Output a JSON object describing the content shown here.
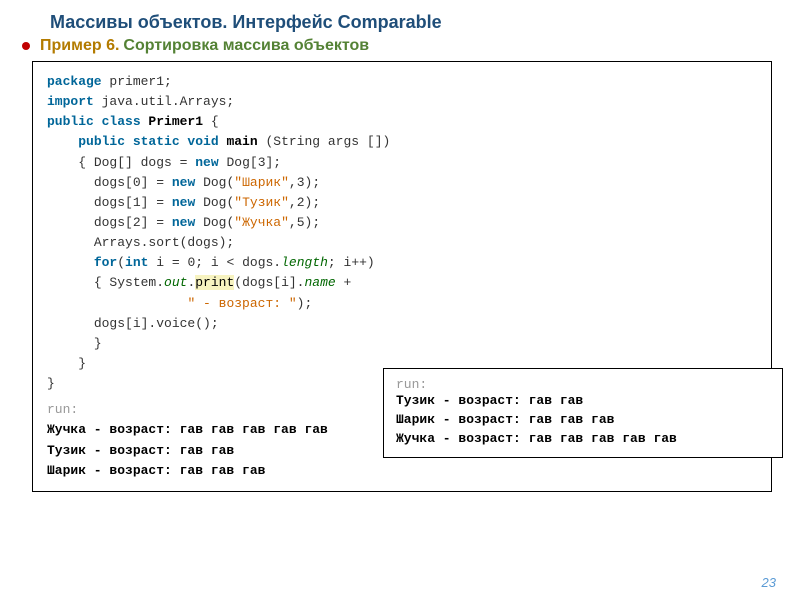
{
  "header": {
    "title": "Массивы объектов. Интерфейс Comparable",
    "example": "Пример 6.",
    "desc": "Сортировка массива объектов"
  },
  "code": {
    "ind1": "    ",
    "ind2": "      ",
    "ind4": "                  ",
    "l1": {
      "a": "package ",
      "b": "primer1;"
    },
    "l2": {
      "a": "import ",
      "b": "java.util.Arrays;"
    },
    "l3": {
      "a": "public class ",
      "b": "Primer1",
      "c": " {"
    },
    "l4": {
      "a": "public static void ",
      "b": "main",
      "c": " (String args [])"
    },
    "l5": {
      "a": "{ Dog[] dogs = ",
      "b": "new ",
      "c": "Dog[",
      "d": "3",
      "e": "];"
    },
    "l6": {
      "a": "dogs[",
      "b": "0",
      "c": "] = ",
      "d": "new ",
      "e": "Dog(",
      "f": "\"Шарик\"",
      "g": ",",
      "h": "3",
      "i": ");"
    },
    "l7": {
      "a": "dogs[",
      "b": "1",
      "c": "] = ",
      "d": "new ",
      "e": "Dog(",
      "f": "\"Тузик\"",
      "g": ",",
      "h": "2",
      "i": ");"
    },
    "l8": {
      "a": "dogs[",
      "b": "2",
      "c": "] = ",
      "d": "new ",
      "e": "Dog(",
      "f": "\"Жучка\"",
      "g": ",",
      "h": "5",
      "i": ");"
    },
    "l9": {
      "a": "Arrays.sort(dogs);"
    },
    "l10": {
      "a": "for",
      "b": "(",
      "c": "int ",
      "d": "i = ",
      "e": "0",
      "f": "; i < dogs.",
      "g": "length",
      "h": "; i++)"
    },
    "l11": {
      "a": "{ System.",
      "b": "out",
      "c": ".",
      "d": "print",
      "e": "(dogs[i].",
      "f": "name",
      "g": " +"
    },
    "l12": {
      "a": "\" - возраст: \"",
      "b": ");"
    },
    "l13": {
      "a": "dogs[i].voice();"
    },
    "l14": {
      "a": "}"
    },
    "l15": {
      "a": "}"
    },
    "l16": {
      "a": "}"
    }
  },
  "inner_output": {
    "run": "run:",
    "lines": [
      "Тузик - возраст: гав гав",
      "Шарик - возраст: гав гав гав",
      "Жучка - возраст: гав гав гав гав гав"
    ]
  },
  "outer_output": {
    "run": "run:",
    "lines": [
      "Жучка - возраст: гав гав гав гав гав",
      "Тузик - возраст: гав гав",
      "Шарик - возраст: гав гав гав"
    ]
  },
  "footer": {
    "page": "23"
  }
}
